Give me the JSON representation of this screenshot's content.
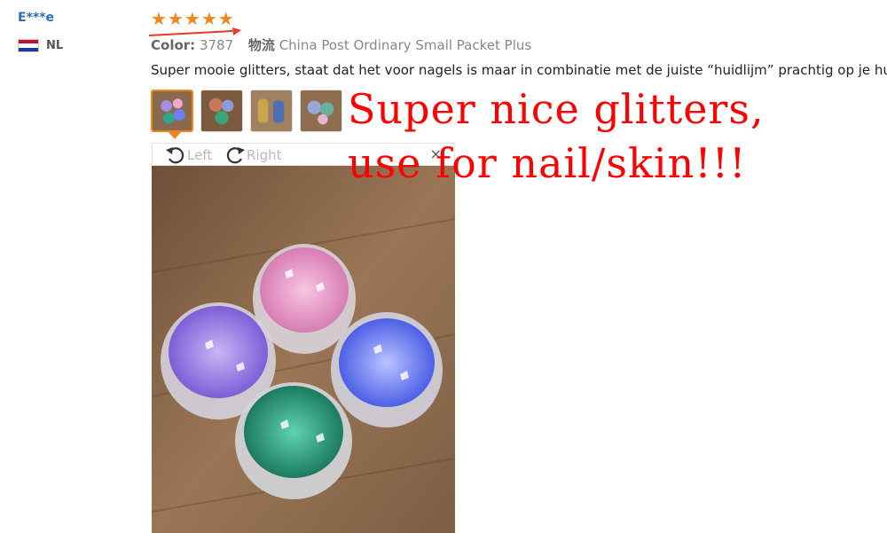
{
  "reviewer": {
    "name": "E***e",
    "country": "NL",
    "flag_colors": [
      "#c8102e",
      "#ffffff",
      "#1f3a93"
    ]
  },
  "rating": {
    "stars": 5,
    "star_color": "#f0861b"
  },
  "order_meta": {
    "color_label": "Color:",
    "color_value": "3787",
    "shipping_label": "物流",
    "shipping_value": "China Post Ordinary Small Packet Plus"
  },
  "review_text": "Super mooie glitters, staat dat het voor nagels is maar in combinatie met de juiste “huidlijm” prachtig op je huid!",
  "thumbnails": [
    {
      "name": "photo-1",
      "selected": true
    },
    {
      "name": "photo-2",
      "selected": false
    },
    {
      "name": "photo-3",
      "selected": false
    },
    {
      "name": "photo-4",
      "selected": false
    }
  ],
  "viewer": {
    "rotate_left_label": "Left",
    "rotate_right_label": "Right",
    "close_symbol": "×"
  },
  "overlay_text": {
    "line1": "Super nice glitters,",
    "line2": "use for nail/skin!!!",
    "color": "#ff0000"
  },
  "accent_color": "#f0861b"
}
